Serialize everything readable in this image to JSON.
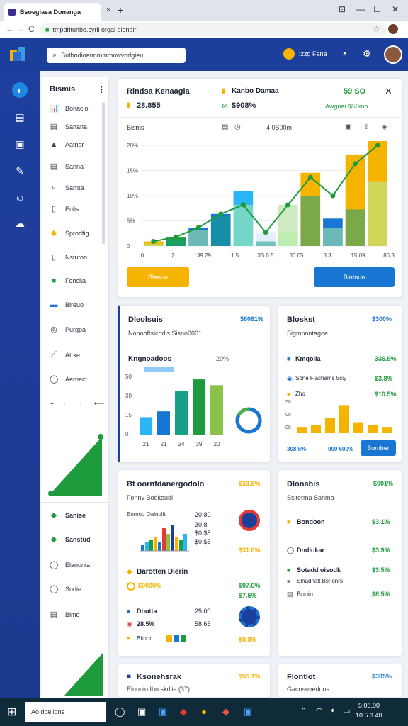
{
  "browser": {
    "tab_title": "Bsoegiasa Donanga",
    "tab_close": "×",
    "new_tab": "+",
    "win_btn1": "⊡",
    "win_btn2": "—",
    "win_btn3": "☐",
    "win_btn4": "✕",
    "url": "tmpdritunbo.cyril orgal dlonbiri",
    "star": "☆"
  },
  "topnav": {
    "search_placeholder": "Sutbodioennmmmnwvodgieu",
    "user_name": "Izzg Fana"
  },
  "sidebar": {
    "title": "Bismis",
    "more": "⋮",
    "items": [
      {
        "label": "Bonaclo",
        "icon": "📊"
      },
      {
        "label": "Sanana",
        "icon": "▤"
      },
      {
        "label": "Aatnar",
        "icon": "▲"
      },
      {
        "label": "Sanna",
        "icon": "▤"
      },
      {
        "label": "Sarnta",
        "icon": "⌕"
      },
      {
        "label": "Eulis",
        "icon": "▯"
      },
      {
        "label": "Sprodtig",
        "icon": "◆"
      },
      {
        "label": "Nstutoo",
        "icon": "▯"
      },
      {
        "label": "Fensija",
        "icon": "■"
      },
      {
        "label": "Bireuo",
        "icon": "▬"
      },
      {
        "label": "Purgpa",
        "icon": "◎"
      },
      {
        "label": "Atrke",
        "icon": "⟋"
      },
      {
        "label": "Aernect",
        "icon": "◯"
      }
    ],
    "tool_icons": [
      "⌁",
      "⌐",
      "⊤",
      "⟵"
    ],
    "bottom_items": [
      {
        "label": "Sanise",
        "icon": "◆"
      },
      {
        "label": "Sanstud",
        "icon": "◆"
      },
      {
        "label": "Elanonia",
        "icon": "◯"
      },
      {
        "label": "Sudie",
        "icon": "◯"
      },
      {
        "label": "Bimo",
        "icon": "▤"
      }
    ]
  },
  "main_card": {
    "title": "Rindsa Kenaagia",
    "stat1": "28.855",
    "label2": "Kanbo Damaa",
    "stat2": "$908%",
    "stat3": "59 SO",
    "stat3b": "Awgnar $50mo",
    "close": "✕",
    "sub_left": "Bisms",
    "sub_mid": "-4  0S00m",
    "y_ticks": [
      "20%",
      "15%",
      "10%",
      "5%",
      "0"
    ],
    "x_ticks": [
      "0",
      "2",
      "39.29",
      "1.5",
      "3S 0.5",
      "30.05",
      "3.3",
      "15.09",
      "86 3"
    ],
    "btn_left": "Blanun",
    "btn_right": "Bintnun"
  },
  "chart_main": {
    "type": "bar",
    "series": [
      {
        "values": [
          1,
          2,
          4,
          7,
          12,
          3,
          9,
          16,
          6,
          20,
          30
        ]
      },
      {
        "values": [
          0.5,
          1.5,
          3.5,
          6.5,
          9,
          1,
          3,
          11,
          4,
          8,
          14
        ]
      }
    ],
    "line_values": [
      1,
      2,
      4,
      7,
      9,
      3,
      9,
      15,
      11,
      18,
      22
    ],
    "ylim": [
      0,
      22
    ]
  },
  "card_bars": {
    "title": "Dleolsuis",
    "pct": "$6081%",
    "subtitle": "Nonooftsicodis Sisno0001",
    "inner_title": "Kngnoadoos",
    "inner_pct": "20%",
    "tag_label": "",
    "y_ticks": [
      "50",
      "30",
      "15",
      "0"
    ],
    "x_ticks": [
      "21",
      "21",
      "24",
      "39",
      "20"
    ],
    "values": [
      12,
      16,
      30,
      38,
      34
    ]
  },
  "chart_bars": {
    "type": "bar",
    "values": [
      12,
      16,
      30,
      38,
      34
    ],
    "ylim": [
      0,
      40
    ],
    "donut_pct": 82
  },
  "card_right1": {
    "title": "Bloskst",
    "pct": "$300%",
    "sub": "Sigmnontagoe",
    "row1": "Kmqoiia",
    "row1_pct": "336.9%",
    "row2": "Sone Flachams 5ciy",
    "row2_pct": "$3.8%",
    "row3": "Zho",
    "row3_pct": "$10.5%",
    "y_ticks": [
      "50",
      "00",
      "00"
    ],
    "x_left": "308.5%",
    "x_mid": "000 600%",
    "btn": "Bomber"
  },
  "chart_right1": {
    "type": "bar",
    "values": [
      4,
      5,
      10,
      18,
      7,
      5,
      4
    ],
    "ylim": [
      0,
      20
    ]
  },
  "card_mid": {
    "title": "Bt oornfdanergodolo",
    "pct": "$33.8%",
    "subtitle": "Fonnv Bodkoudi",
    "row_label": "Enmoo Oalnolit",
    "nums": [
      "20.80",
      "30.8",
      "$0.$5",
      "$0.$5"
    ],
    "right_pct": "$31.0%",
    "sec_title": "Barotten Dierin",
    "sec_stat": "$0000%",
    "sec_stat2": "$07.0%",
    "sec_stat3": "$7.5%",
    "sec2_title": "Dbotta",
    "sec2_stat": "25.00",
    "sec2_stat2": "28.5%",
    "sec2_stat3": "58.65",
    "sec2_pct": "$0.8%",
    "bottom_label": "Bitoot"
  },
  "chart_mid": {
    "type": "bar",
    "values": [
      2,
      3,
      4,
      5,
      3,
      8,
      6,
      9,
      5,
      4,
      6
    ],
    "ylim": [
      0,
      10
    ]
  },
  "card_right2": {
    "title": "Dlonabis",
    "pct": "$001%",
    "sub": "Ssiterma Sahma",
    "rows": [
      {
        "label": "Bondoon",
        "pct": "$3.1%"
      },
      {
        "label": "Dndlokar",
        "pct": "$3.9%"
      },
      {
        "label": "Sotadd oisodk",
        "pct": "$3.5%"
      },
      {
        "label": "Slnadnalt Bsrlonrs",
        "pct": ""
      },
      {
        "label": "Buoin",
        "pct": "$8.5%"
      }
    ]
  },
  "card_bottom1": {
    "title": "Ksonehsrak",
    "pct": "$55.1%",
    "sub": "Elnnnio Ibn skrllia (37)"
  },
  "card_bottom2": {
    "title": "Flontlot",
    "pct": "$305%",
    "sub": "Gacosnvedons"
  },
  "taskbar": {
    "search": "Ao dbeilone",
    "time": "5:08.00",
    "date": "10.5.3.40"
  },
  "colors": {
    "accent": "#1d3f9c",
    "yellow": "#f5b400",
    "green": "#1e9b3c",
    "blue": "#1976d2"
  }
}
